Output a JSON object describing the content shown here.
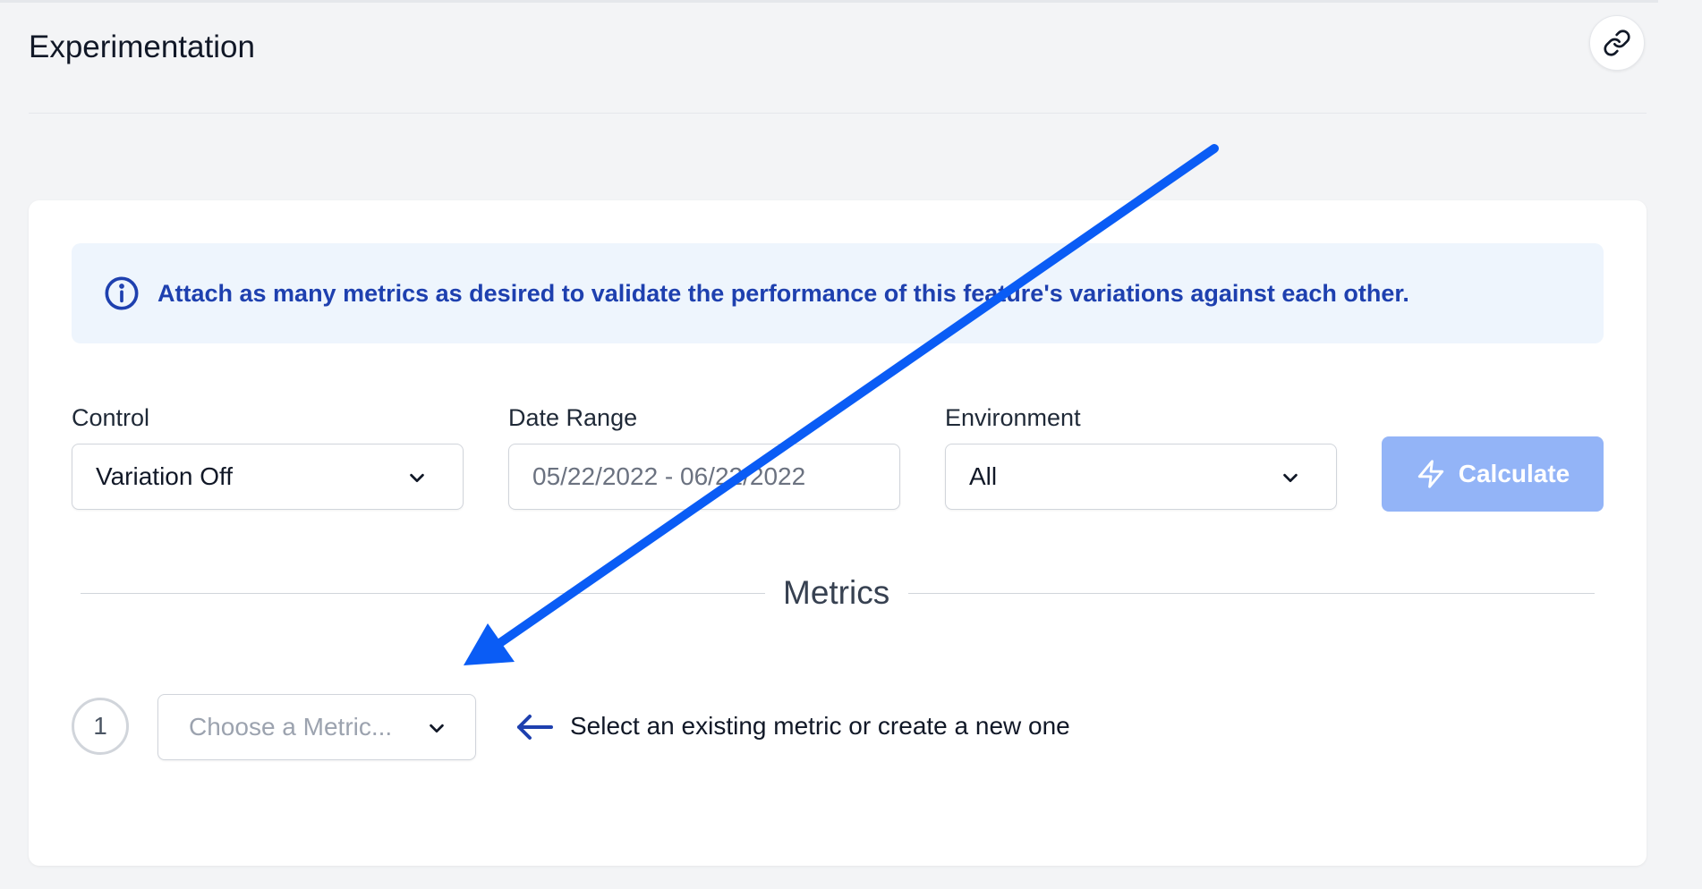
{
  "page": {
    "title": "Experimentation"
  },
  "header": {
    "link_button_icon": "link-icon"
  },
  "info_banner": {
    "icon": "info-circle-icon",
    "text": "Attach as many metrics as desired to validate the performance of this feature's variations against each other."
  },
  "fields": {
    "control": {
      "label": "Control",
      "value": "Variation Off"
    },
    "date_range": {
      "label": "Date Range",
      "value": "05/22/2022 - 06/22/2022"
    },
    "environment": {
      "label": "Environment",
      "value": "All"
    }
  },
  "calculate_button": {
    "label": "Calculate",
    "icon": "lightning-bolt-icon"
  },
  "metrics": {
    "title": "Metrics",
    "rows": [
      {
        "number": "1",
        "placeholder": "Choose a Metric...",
        "hint": "Select an existing metric or create a new one",
        "hint_icon": "arrow-left-icon"
      }
    ]
  },
  "colors": {
    "accent_blue": "#1e40af",
    "annotation_arrow": "#0a5cf5",
    "calculate_disabled": "#93b4f7",
    "banner_bg": "#eef5fd"
  }
}
